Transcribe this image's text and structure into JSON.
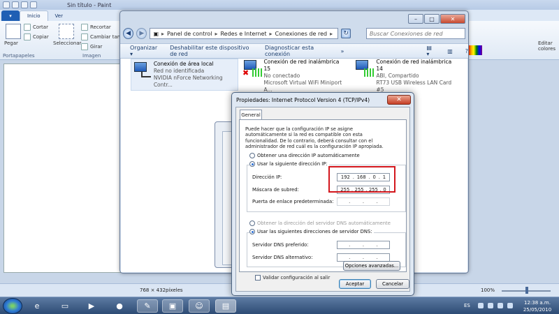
{
  "paint": {
    "title": "Sin título - Paint",
    "file_tab": "▾",
    "tabs": [
      "Inicio",
      "Ver"
    ],
    "ribbon": {
      "paste": "Pegar",
      "cut": "Cortar",
      "copy": "Copiar",
      "select": "Seleccionar",
      "crop": "Recortar",
      "resize": "Cambiar tama",
      "rotate": "Girar",
      "group_clipboard": "Portapapeles",
      "group_image": "Imagen",
      "colors_edit": "Editar colores"
    },
    "status": {
      "size": "768 × 432píxeles",
      "zoom": "100%"
    }
  },
  "network_window": {
    "address": {
      "part1": "Panel de control",
      "part2": "Redes e Internet",
      "part3": "Conexiones de red"
    },
    "search_placeholder": "Buscar Conexiones de red",
    "toolbar": {
      "organize": "Organizar ▾",
      "disable": "Deshabilitar este dispositivo de red",
      "diagnose": "Diagnosticar esta conexión",
      "more": "»"
    },
    "connections": [
      {
        "name": "Conexión de área local",
        "status": "Red no identificada",
        "device": "NVIDIA nForce Networking Contr..."
      },
      {
        "name": "Conexión de red inalámbrica 15",
        "status": "No conectado",
        "device": "Microsoft Virtual WiFi Miniport A..."
      },
      {
        "name": "Conexión de red inalámbrica 14",
        "status": "ABI, Compartido",
        "device": "RT73 USB Wireless LAN Card #5"
      }
    ]
  },
  "ipv4_dialog": {
    "title": "Propiedades: Internet Protocol Version 4 (TCP/IPv4)",
    "close": "✕",
    "tab": "General",
    "description": "Puede hacer que la configuración IP se asigne automáticamente si la red es compatible con esta funcionalidad. De lo contrario, deberá consultar con el administrador de red cuál es la configuración IP apropiada.",
    "ip_auto": "Obtener una dirección IP automáticamente",
    "ip_manual": "Usar la siguiente dirección IP:",
    "ip_label": "Dirección IP:",
    "ip_value": [
      "192",
      "168",
      "0",
      "1"
    ],
    "mask_label": "Máscara de subred:",
    "mask_value": [
      "255",
      "255",
      "255",
      "0"
    ],
    "gateway_label": "Puerta de enlace predeterminada:",
    "dns_auto": "Obtener la dirección del servidor DNS automáticamente",
    "dns_manual": "Usar las siguientes direcciones de servidor DNS:",
    "dns_pref_label": "Servidor DNS preferido:",
    "dns_alt_label": "Servidor DNS alternativo:",
    "validate": "Validar configuración al salir",
    "advanced": "Opciones avanzadas...",
    "ok": "Aceptar",
    "cancel": "Cancelar",
    "highlight_color": "#d3161c"
  },
  "taskbar": {
    "lang": "ES",
    "time": "12:38 a.m.",
    "date": "25/05/2010"
  }
}
